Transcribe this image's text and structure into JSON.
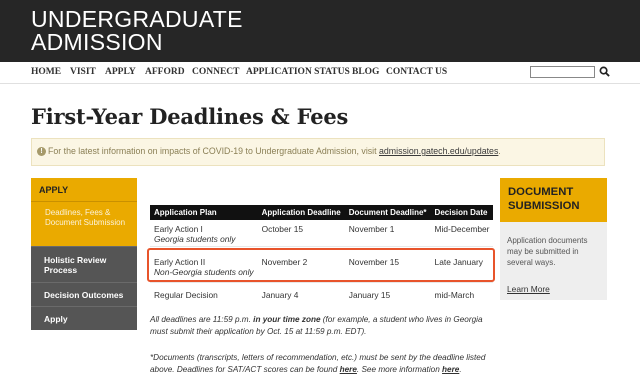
{
  "header": {
    "logo_line1": "UNDERGRADUATE",
    "logo_line2": "ADMISSION"
  },
  "nav": {
    "items": [
      "HOME",
      "VISIT",
      "APPLY",
      "AFFORD",
      "CONNECT",
      "APPLICATION STATUS",
      "BLOG",
      "CONTACT US"
    ]
  },
  "search": {
    "placeholder": ""
  },
  "page": {
    "title": "First-Year Deadlines & Fees"
  },
  "alert": {
    "text": "For the latest information on impacts of COVID-19 to Undergraduate Admission, visit ",
    "link": "admission.gatech.edu/updates",
    "end": "."
  },
  "sidebar": {
    "header": "APPLY",
    "sub_item": "Deadlines, Fees & Document Submission",
    "items": [
      "Holistic Review Process",
      "Decision Outcomes",
      "Apply"
    ]
  },
  "table": {
    "headers": [
      "Application Plan",
      "Application Deadline",
      "Document Deadline*",
      "Decision Date"
    ],
    "rows": [
      {
        "plan": "Early Action I",
        "note": "Georgia students only",
        "app": "October 15",
        "doc": "November 1",
        "decision": "Mid-December"
      },
      {
        "plan": "Early Action II",
        "note": "Non-Georgia students only",
        "app": "November 2",
        "doc": "November 15",
        "decision": "Late January"
      },
      {
        "plan": "Regular Decision",
        "note": "",
        "app": "January 4",
        "doc": "January 15",
        "decision": "mid-March"
      }
    ]
  },
  "footnotes": {
    "f1_a": "All deadlines are 11:59 p.m. ",
    "f1_b": "in your time zone",
    "f1_c": " (for example, a student who lives in Georgia must submit their application by Oct. 15 at 11:59 p.m. EDT).",
    "f2_a": "*Documents (transcripts, letters of recommendation, etc.) must be sent by the deadline listed above. Deadlines for SAT/ACT scores can be found ",
    "f2_link1": "here",
    "f2_b": ". See more information ",
    "f2_link2": "here",
    "f2_c": "."
  },
  "doc_box": {
    "title": "DOCUMENT SUBMISSION",
    "text": "Application documents may be submitted in several ways.",
    "link": "Learn More"
  },
  "colors": {
    "gold": "#eaaa00",
    "header_bg": "#262626",
    "highlight": "#e8542b"
  }
}
